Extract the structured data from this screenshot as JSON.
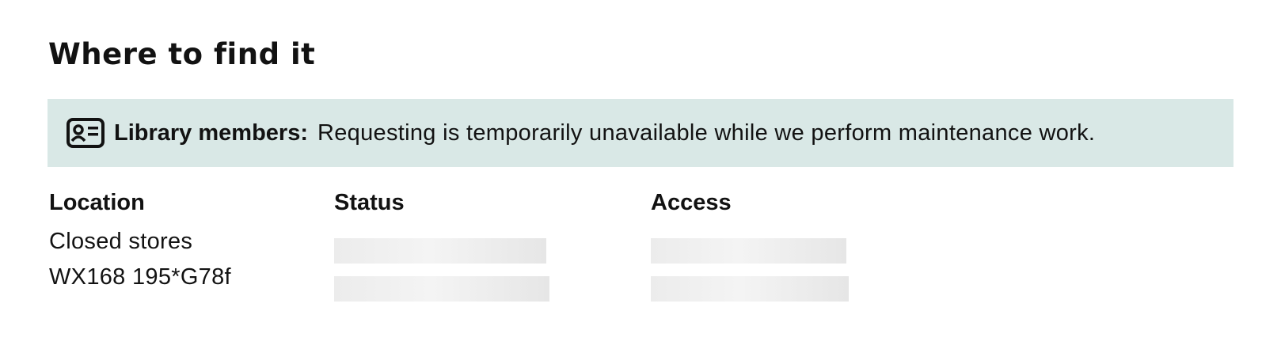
{
  "heading": "Where to find it",
  "notice": {
    "icon": "member-card-icon",
    "label": "Library members:",
    "message": "Requesting is temporarily unavailable while we perform maintenance work."
  },
  "table": {
    "headers": {
      "location": "Location",
      "status": "Status",
      "access": "Access"
    },
    "location_lines": [
      "Closed stores",
      "WX168 195*G78f"
    ]
  }
}
